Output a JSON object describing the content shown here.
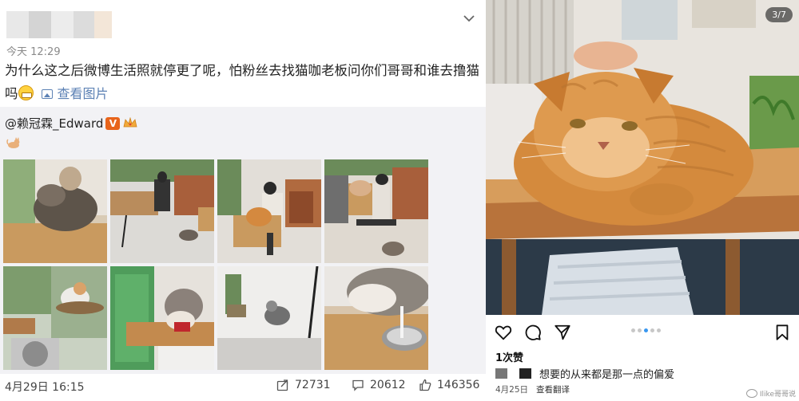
{
  "weibo": {
    "timestamp": "今天 12:29",
    "post_text": "为什么这之后微博生活照就停更了呢，怕粉丝去找猫咖老板问你们哥哥和谁去撸猫吗",
    "view_pictures_label": "查看图片",
    "repost": {
      "author_handle": "@赖冠霖_Edward",
      "verified_badge": "V",
      "photo_count": 8
    },
    "footer": {
      "date": "4月29日 16:15",
      "reposts": "72731",
      "comments": "20612",
      "likes": "146356"
    }
  },
  "instagram": {
    "image_counter": "3/7",
    "carousel_dots": 5,
    "active_dot": 2,
    "likes": "1次赞",
    "caption": "想要的从来都是那一点的偏爱",
    "date": "4月25日",
    "translate_label": "查看翻译",
    "watermark": "Ilike哥哥说"
  },
  "icons": {
    "weibo_chevron": "chevron-down-icon",
    "view_pics": "image-icon",
    "repost": "share-icon",
    "comment": "comment-icon",
    "like": "thumbs-up-icon",
    "ig_like": "heart-icon",
    "ig_comment": "comment-bubble-icon",
    "ig_share": "send-icon",
    "ig_save": "bookmark-icon"
  }
}
